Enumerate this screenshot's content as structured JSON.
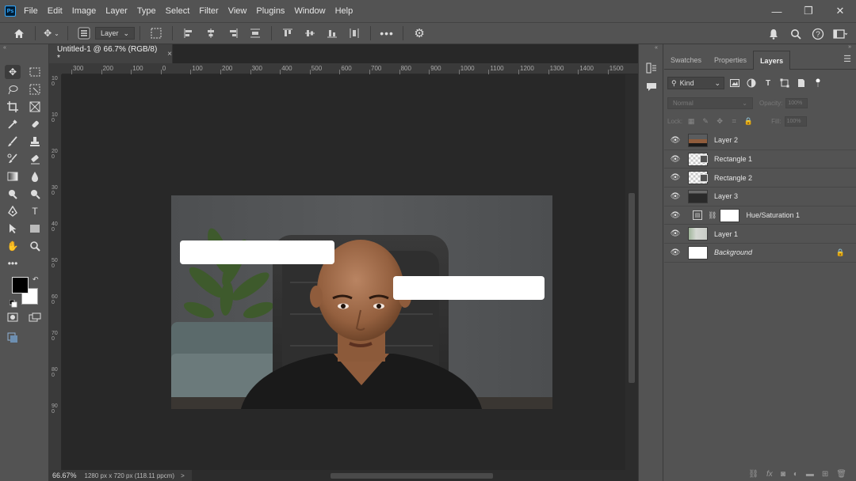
{
  "menu": [
    "File",
    "Edit",
    "Image",
    "Layer",
    "Type",
    "Select",
    "Filter",
    "View",
    "Plugins",
    "Window",
    "Help"
  ],
  "app": {
    "logo": "Ps"
  },
  "window_controls": {
    "minimize": "—",
    "restore": "❐",
    "close": "✕"
  },
  "options_bar": {
    "auto_select_value": "Layer"
  },
  "document": {
    "tab_title": "Untitled-1 @ 66.7% (RGB/8) *",
    "tab_close": "×",
    "zoom": "66.67%",
    "doc_size": "1280 px x 720 px (118.11 ppcm)",
    "status_arrow": ">"
  },
  "ruler_top_labels": [
    "300",
    "200",
    "100",
    "0",
    "100",
    "200",
    "300",
    "400",
    "500",
    "600",
    "700",
    "800",
    "900",
    "1000",
    "1100",
    "1200",
    "1300",
    "1400",
    "1500"
  ],
  "ruler_left_labels": [
    "100",
    "100",
    "200",
    "300",
    "400",
    "500",
    "600",
    "700",
    "800",
    "900"
  ],
  "panel": {
    "tabs": [
      "Swatches",
      "Properties",
      "Layers"
    ],
    "active_tab": "Layers",
    "kind_filter": "Kind",
    "blend_mode": "Normal",
    "opacity_label": "Opacity:",
    "opacity_value": "100%",
    "lock_label": "Lock:",
    "fill_label": "Fill:",
    "fill_value": "100%"
  },
  "layers": [
    {
      "name": "Layer 2",
      "thumb": "photo"
    },
    {
      "name": "Rectangle 1",
      "thumb": "checker"
    },
    {
      "name": "Rectangle 2",
      "thumb": "checker"
    },
    {
      "name": "Layer 3",
      "thumb": "dark"
    },
    {
      "name": "Hue/Saturation 1",
      "thumb": "adjustment"
    },
    {
      "name": "Layer 1",
      "thumb": "room"
    },
    {
      "name": "Background",
      "thumb": "white",
      "locked": true
    }
  ],
  "colors": {
    "app_bg": "#535353",
    "canvas_bg": "#282828",
    "foreground_color": "#000000",
    "background_color": "#ffffff"
  }
}
